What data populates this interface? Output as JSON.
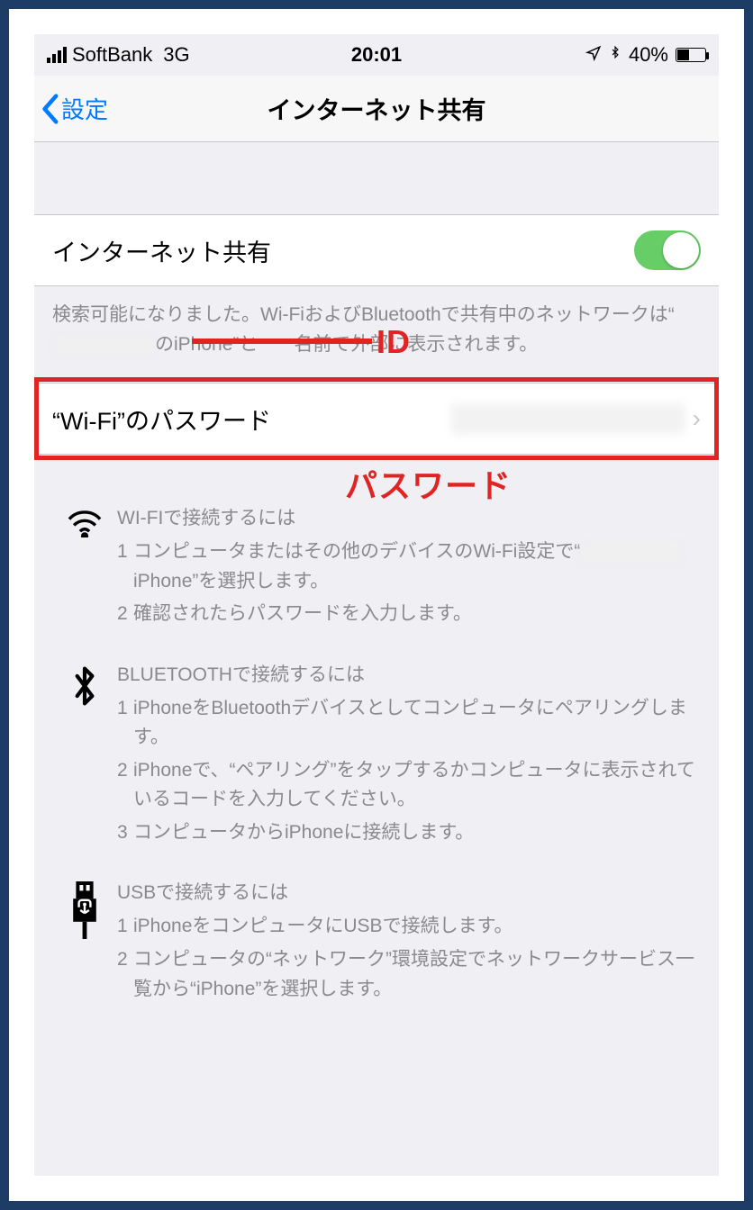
{
  "statusbar": {
    "carrier": "SoftBank",
    "network": "3G",
    "time": "20:01",
    "battery_pct": "40%"
  },
  "nav": {
    "back_label": "設定",
    "title": "インターネット共有"
  },
  "hotspot": {
    "toggle_label": "インターネット共有",
    "toggle_on": true,
    "discoverable_prefix": "検索可能になりました。Wi-FiおよびBluetoothで共有中のネットワークは“",
    "discoverable_mid": "のiPhone”と",
    "discoverable_suffix": "名前で外部に表示されます。"
  },
  "password_row": {
    "label": "“Wi-Fi”のパスワード"
  },
  "annotations": {
    "id": "ID",
    "password": "パスワード"
  },
  "wifi": {
    "heading": "WI-FIで接続するには",
    "step1a": "コンピュータまたはその他のデバイスのWi-Fi設定で“",
    "step1b": "iPhone”を選択します。",
    "step2": "確認されたらパスワードを入力します。"
  },
  "bluetooth": {
    "heading": "BLUETOOTHで接続するには",
    "step1": "iPhoneをBluetoothデバイスとしてコンピュータにペアリングします。",
    "step2": "iPhoneで、“ペアリング”をタップするかコンピュータに表示されているコードを入力してください。",
    "step3": "コンピュータからiPhoneに接続します。"
  },
  "usb": {
    "heading": "USBで接続するには",
    "step1": "iPhoneをコンピュータにUSBで接続します。",
    "step2": "コンピュータの“ネットワーク”環境設定でネットワークサービス一覧から“iPhone”を選択します。"
  }
}
